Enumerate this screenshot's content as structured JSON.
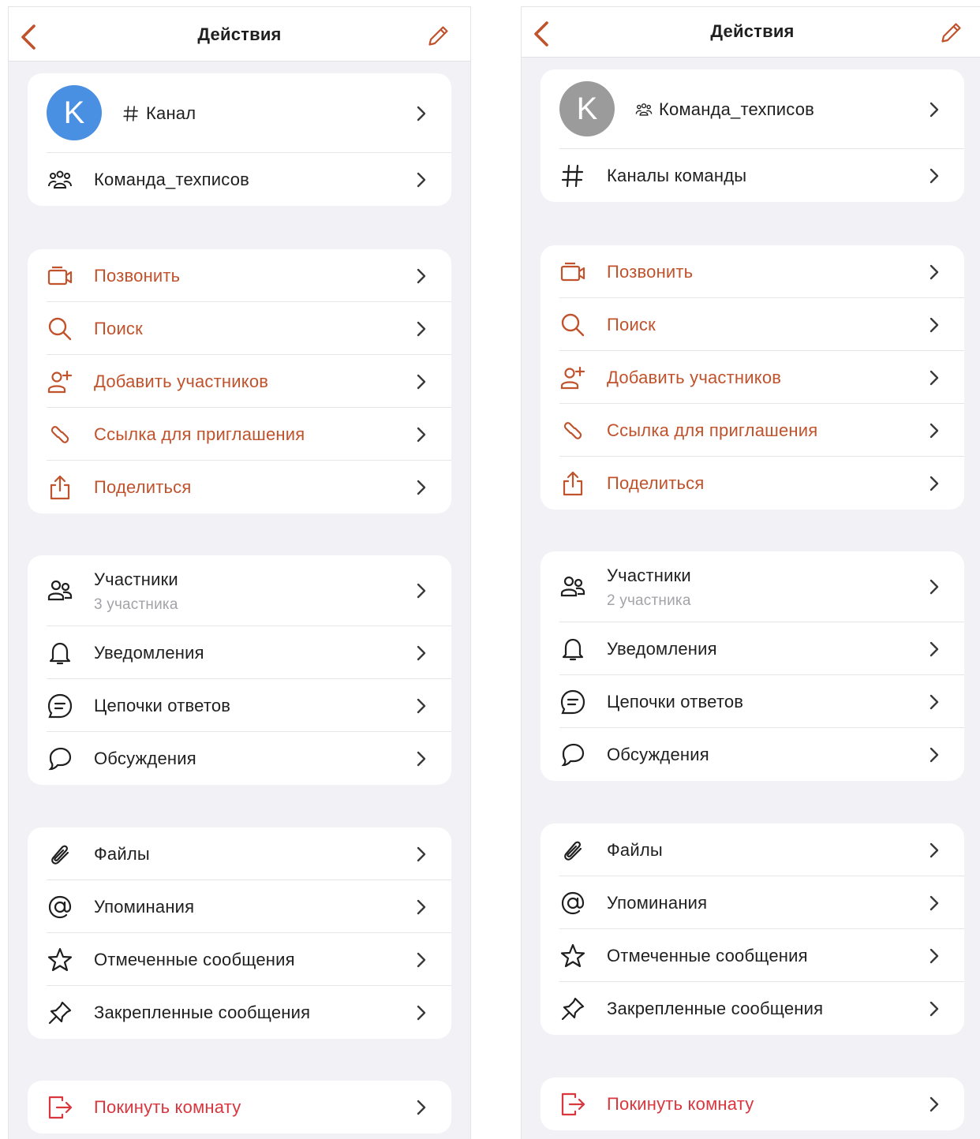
{
  "colors": {
    "accent": "#c0522c",
    "danger": "#d9363e",
    "text": "#1f1f1f",
    "secondary": "#a3a3a8",
    "avatar_left": "#4a90e2",
    "avatar_right": "#9b9b9b",
    "background": "#f2f2f6"
  },
  "left": {
    "title": "Действия",
    "header": {
      "avatar_letter": "K",
      "prefix_icon": "hash-icon",
      "name": "Канал",
      "second_icon": "team-icon",
      "second_label": "Команда_техписов"
    },
    "actions": [
      {
        "icon": "video-camera-icon",
        "label": "Позвонить"
      },
      {
        "icon": "search-icon",
        "label": "Поиск"
      },
      {
        "icon": "add-user-icon",
        "label": "Добавить участников"
      },
      {
        "icon": "link-icon",
        "label": "Ссылка для приглашения"
      },
      {
        "icon": "share-icon",
        "label": "Поделиться"
      }
    ],
    "members": {
      "icon": "users-icon",
      "label": "Участники",
      "count": "3 участника"
    },
    "social": [
      {
        "icon": "bell-icon",
        "label": "Уведомления"
      },
      {
        "icon": "threads-icon",
        "label": "Цепочки ответов"
      },
      {
        "icon": "discussion-icon",
        "label": "Обсуждения"
      }
    ],
    "content": [
      {
        "icon": "paperclip-icon",
        "label": "Файлы"
      },
      {
        "icon": "at-icon",
        "label": "Упоминания"
      },
      {
        "icon": "star-icon",
        "label": "Отмеченные сообщения"
      },
      {
        "icon": "pin-icon",
        "label": "Закрепленные сообщения"
      }
    ],
    "leave": {
      "icon": "logout-icon",
      "label": "Покинуть комнату"
    }
  },
  "right": {
    "title": "Действия",
    "header": {
      "avatar_letter": "K",
      "prefix_icon": "team-icon",
      "name": "Команда_техписов",
      "second_icon": "hash-icon",
      "second_label": "Каналы команды"
    },
    "actions": [
      {
        "icon": "video-camera-icon",
        "label": "Позвонить"
      },
      {
        "icon": "search-icon",
        "label": "Поиск"
      },
      {
        "icon": "add-user-icon",
        "label": "Добавить участников"
      },
      {
        "icon": "link-icon",
        "label": "Ссылка для приглашения"
      },
      {
        "icon": "share-icon",
        "label": "Поделиться"
      }
    ],
    "members": {
      "icon": "users-icon",
      "label": "Участники",
      "count": "2 участника"
    },
    "social": [
      {
        "icon": "bell-icon",
        "label": "Уведомления"
      },
      {
        "icon": "threads-icon",
        "label": "Цепочки ответов"
      },
      {
        "icon": "discussion-icon",
        "label": "Обсуждения"
      }
    ],
    "content": [
      {
        "icon": "paperclip-icon",
        "label": "Файлы"
      },
      {
        "icon": "at-icon",
        "label": "Упоминания"
      },
      {
        "icon": "star-icon",
        "label": "Отмеченные сообщения"
      },
      {
        "icon": "pin-icon",
        "label": "Закрепленные сообщения"
      }
    ],
    "leave": {
      "icon": "logout-icon",
      "label": "Покинуть комнату"
    }
  }
}
